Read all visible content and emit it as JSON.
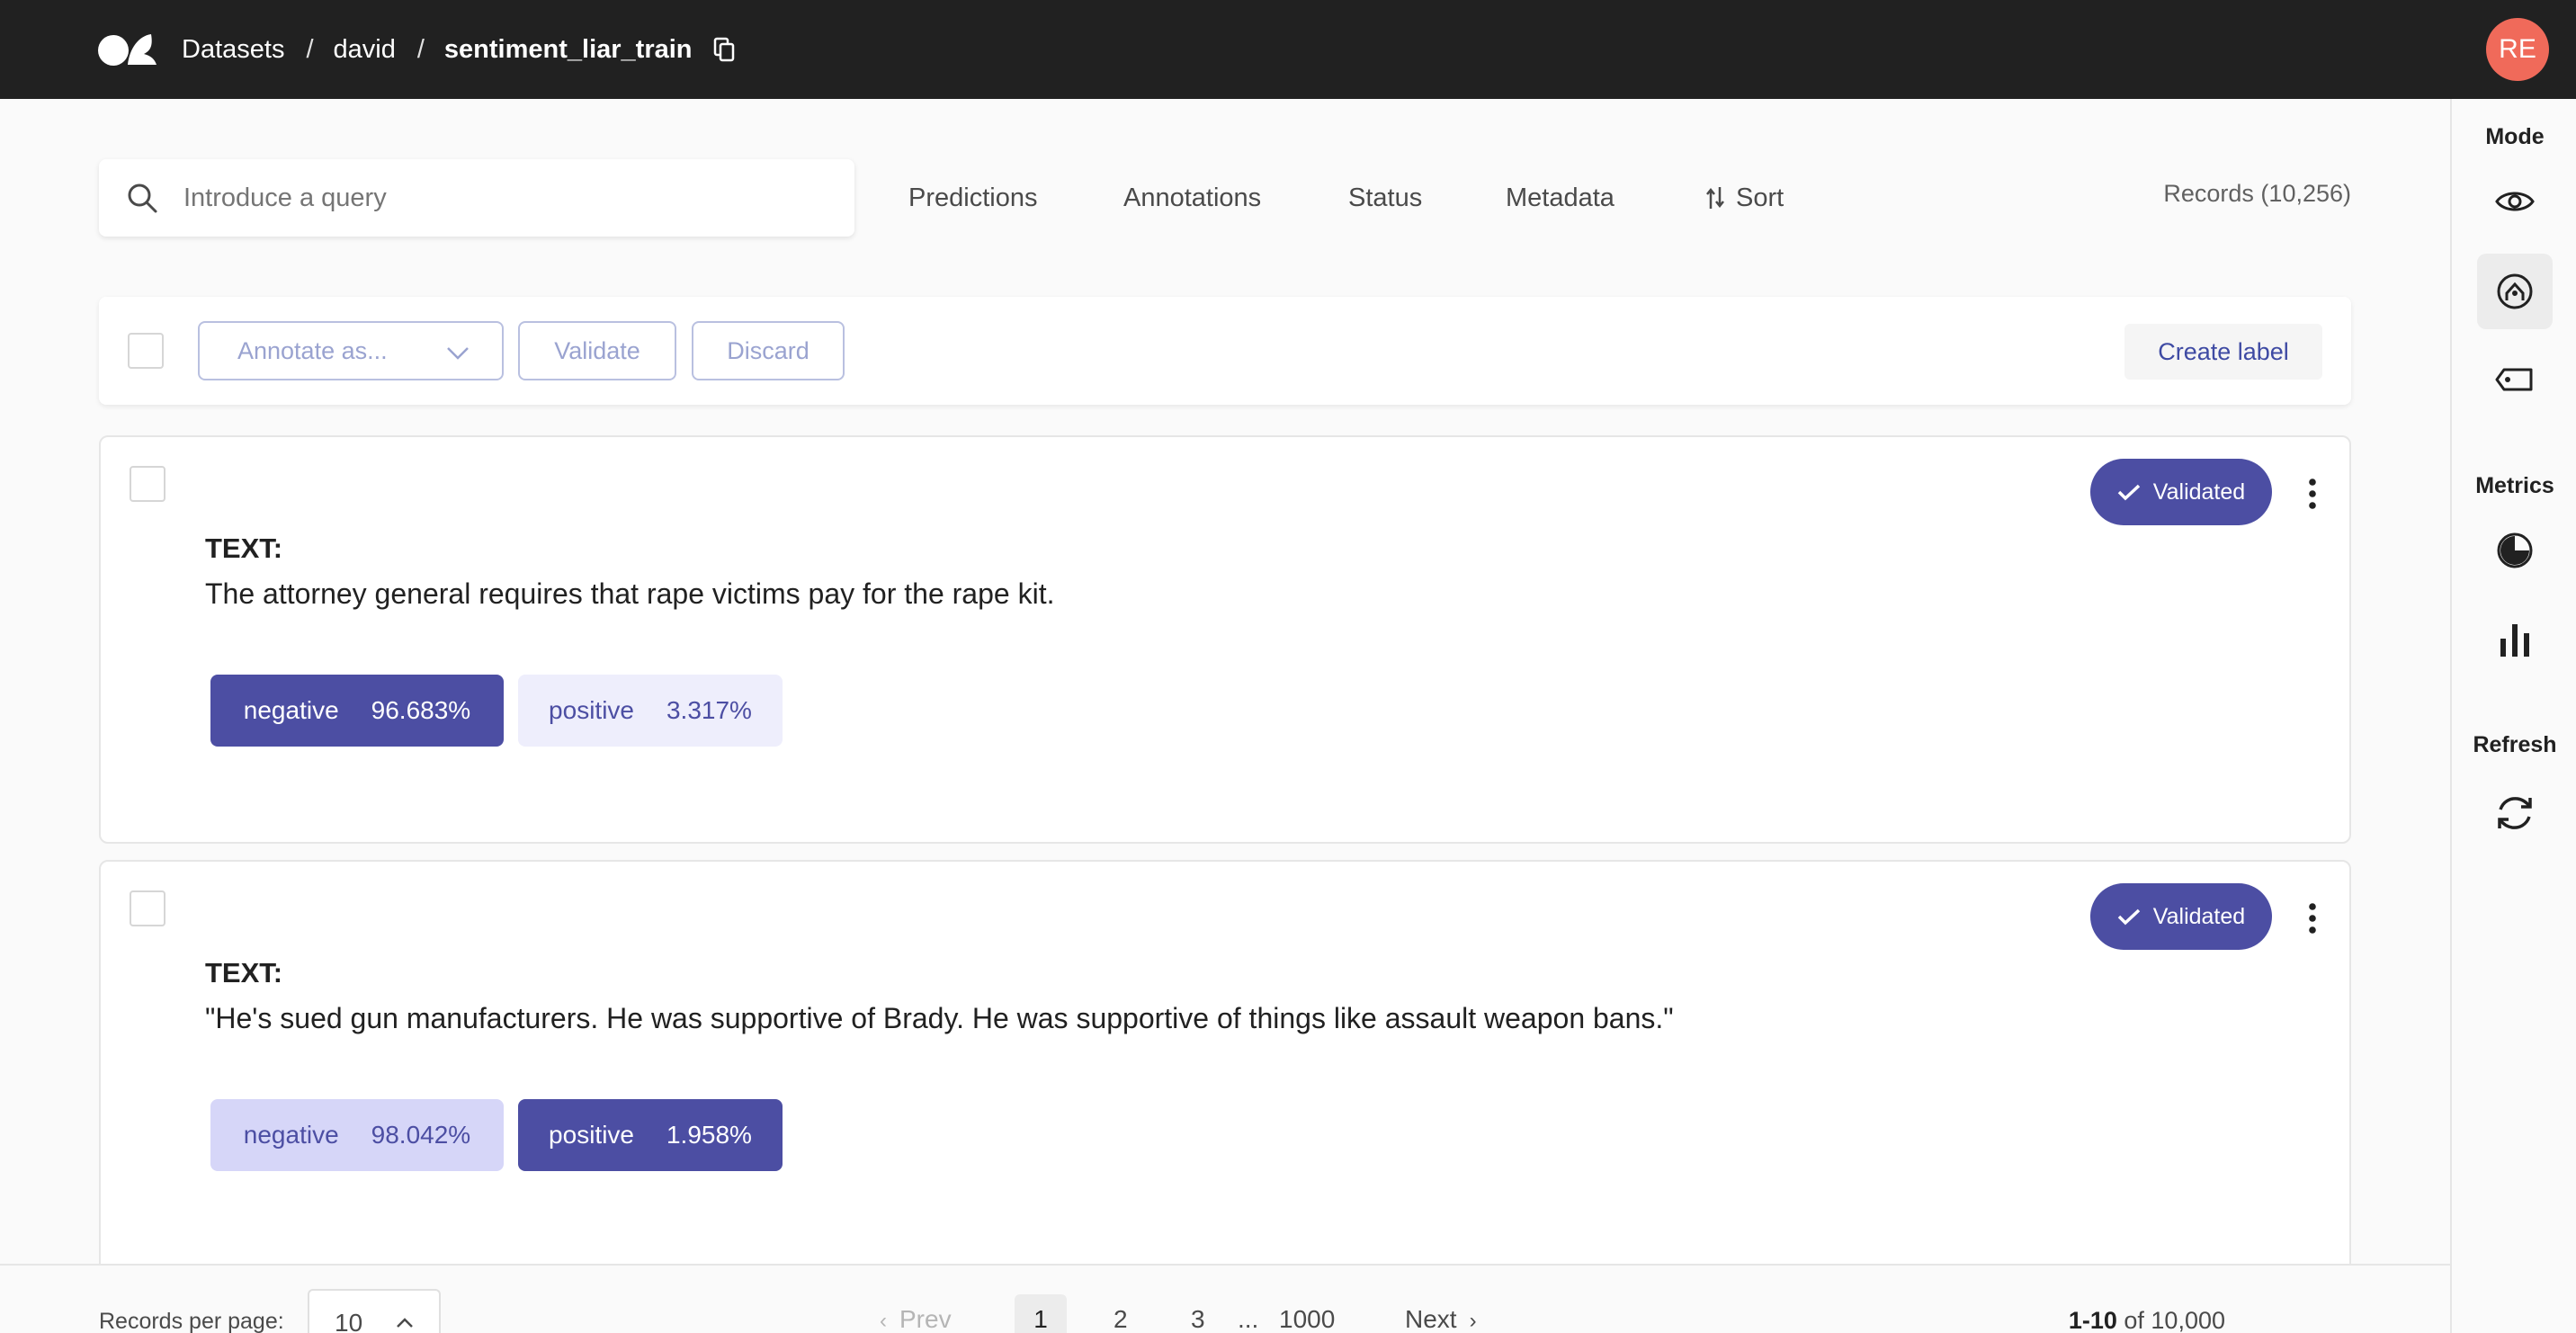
{
  "breadcrumb": {
    "root": "Datasets",
    "separator": "/",
    "owner": "david",
    "dataset": "sentiment_liar_train"
  },
  "user": {
    "initials": "RE",
    "avatar_color": "#f06a5a"
  },
  "search": {
    "placeholder": "Introduce a query",
    "value": ""
  },
  "filters": {
    "predictions": "Predictions",
    "annotations": "Annotations",
    "status": "Status",
    "metadata": "Metadata",
    "sort": "Sort"
  },
  "records_total": "Records (10,256)",
  "bulk": {
    "annotate_as": "Annotate as...",
    "validate": "Validate",
    "discard": "Discard",
    "create_label": "Create label"
  },
  "sidebar": {
    "mode": "Mode",
    "metrics": "Metrics",
    "refresh": "Refresh"
  },
  "records": [
    {
      "status": "Validated",
      "text_label": "TEXT:",
      "text": "The attorney general requires that rape victims pay for the rape kit.",
      "labels": [
        {
          "name": "negative",
          "score": "96.683%",
          "selected": true
        },
        {
          "name": "positive",
          "score": "3.317%",
          "selected": false
        }
      ]
    },
    {
      "status": "Validated",
      "text_label": "TEXT:",
      "text": "\"He's sued gun manufacturers. He was supportive of Brady. He was supportive of things like assault weapon bans.\"",
      "labels": [
        {
          "name": "negative",
          "score": "98.042%",
          "selected": false
        },
        {
          "name": "positive",
          "score": "1.958%",
          "selected": true
        }
      ]
    }
  ],
  "pagination": {
    "per_page_label": "Records per page:",
    "per_page": "10",
    "prev": "Prev",
    "next": "Next",
    "pages": [
      "1",
      "2",
      "3"
    ],
    "ellipsis": "...",
    "last": "1000",
    "range": "1-10",
    "of": "of 10,000"
  },
  "colors": {
    "topbar": "#212121",
    "accent": "#4c4ea3",
    "accent_light": "#eeeefc"
  }
}
